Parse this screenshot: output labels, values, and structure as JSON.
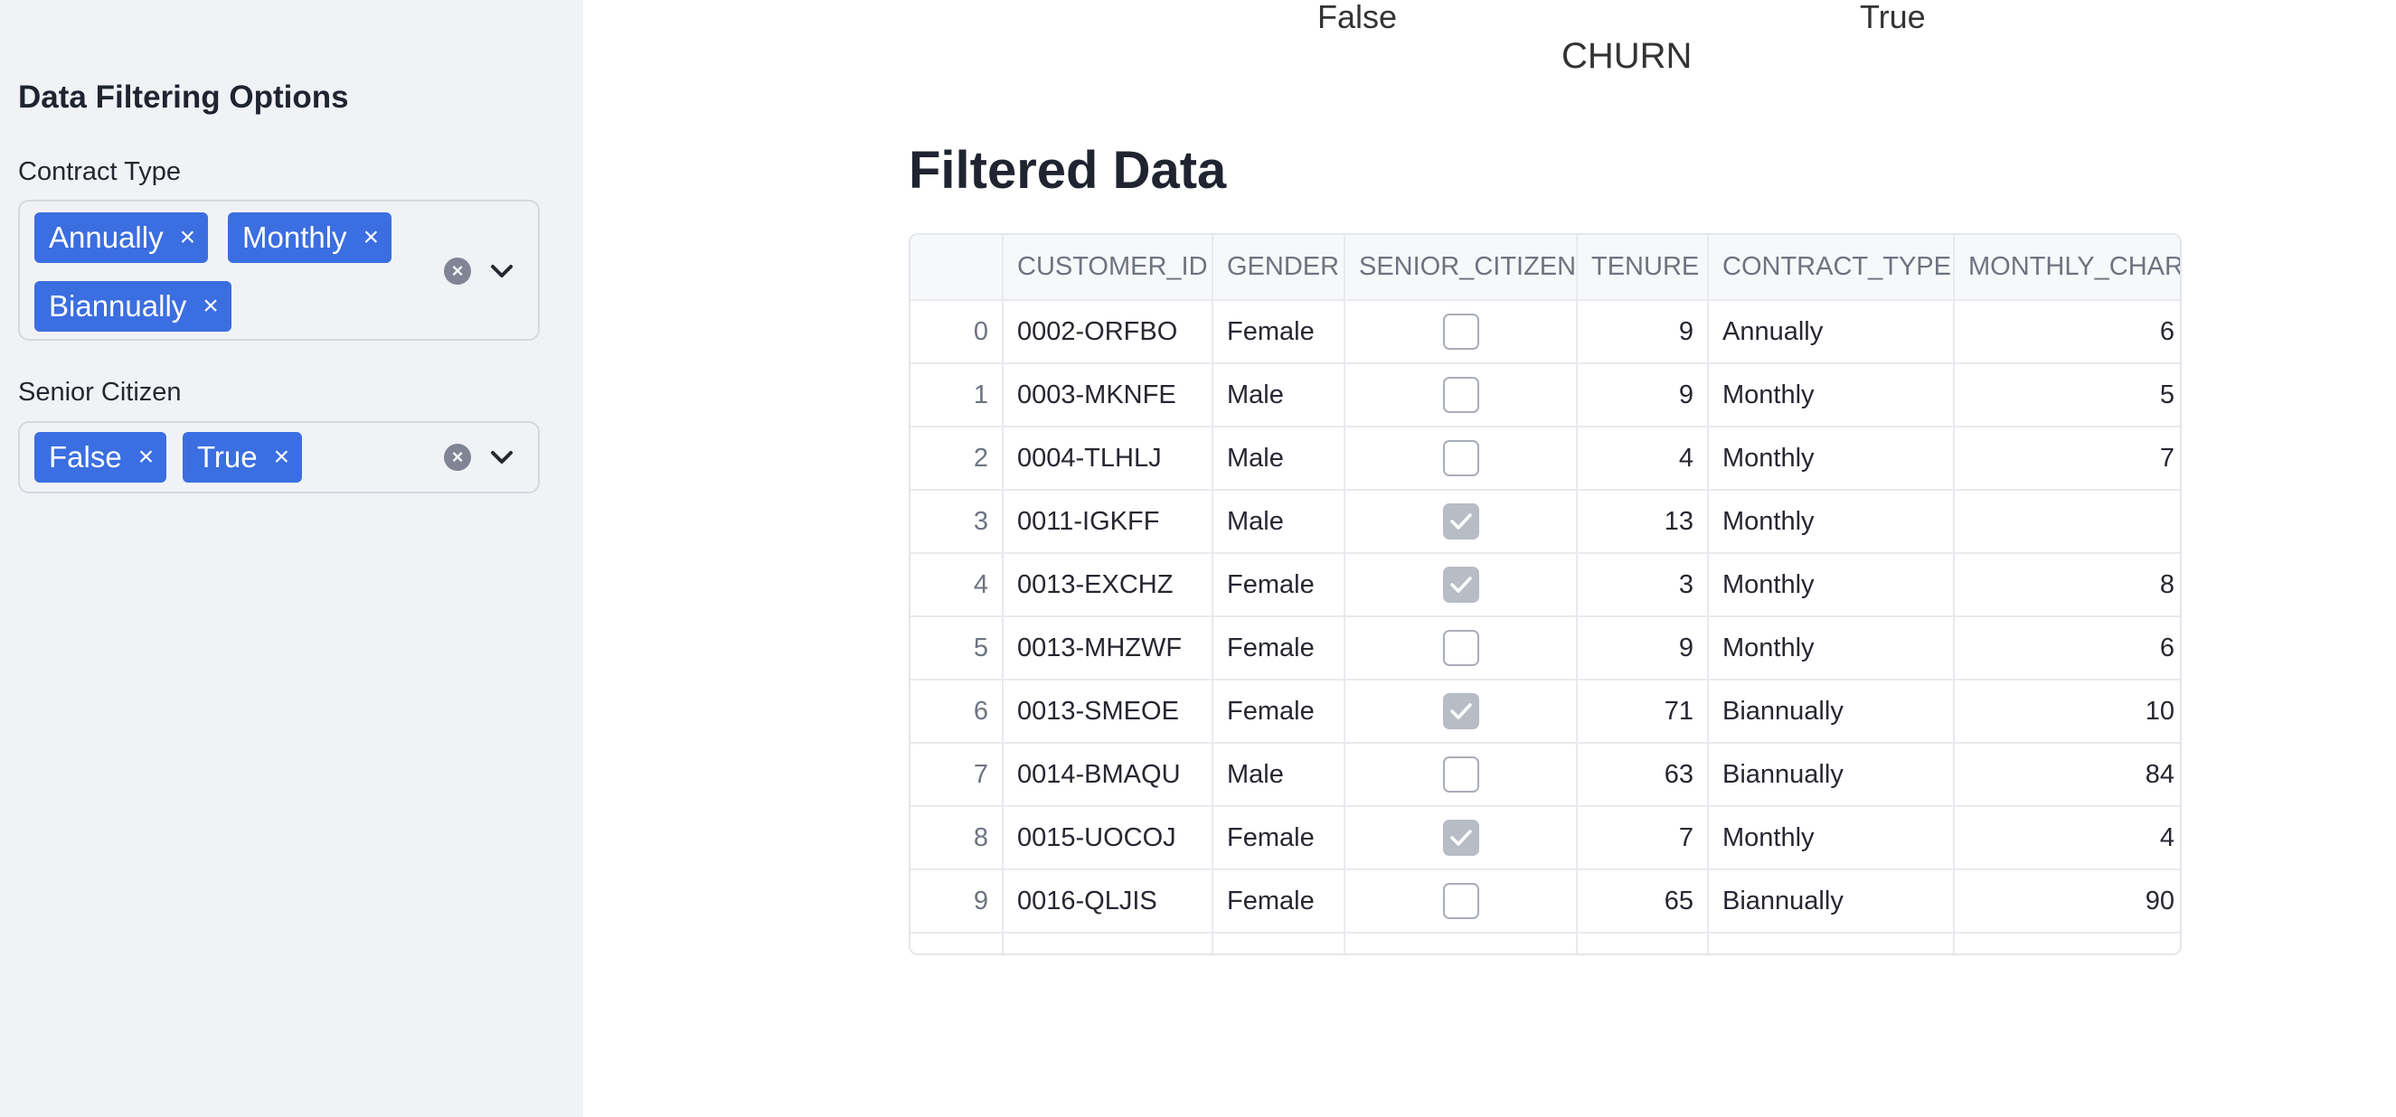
{
  "sidebar": {
    "title": "Data Filtering Options",
    "contract_type": {
      "label": "Contract Type",
      "selected": [
        "Annually",
        "Monthly",
        "Biannually"
      ]
    },
    "senior_citizen": {
      "label": "Senior Citizen",
      "selected": [
        "False",
        "True"
      ]
    },
    "tag_remove_glyph": "×",
    "clear_glyph": "×"
  },
  "chart": {
    "x_tick_labels": [
      "False",
      "True"
    ],
    "x_axis_title": "CHURN"
  },
  "main": {
    "heading": "Filtered Data",
    "table": {
      "columns": [
        "",
        "CUSTOMER_ID",
        "GENDER",
        "SENIOR_CITIZEN",
        "TENURE",
        "CONTRACT_TYPE",
        "MONTHLY_CHARGES"
      ],
      "rows": [
        {
          "index": "0",
          "customer_id": "0002-ORFBO",
          "gender": "Female",
          "senior_citizen": false,
          "tenure": "9",
          "contract_type": "Annually",
          "monthly_charges": "6"
        },
        {
          "index": "1",
          "customer_id": "0003-MKNFE",
          "gender": "Male",
          "senior_citizen": false,
          "tenure": "9",
          "contract_type": "Monthly",
          "monthly_charges": "5"
        },
        {
          "index": "2",
          "customer_id": "0004-TLHLJ",
          "gender": "Male",
          "senior_citizen": false,
          "tenure": "4",
          "contract_type": "Monthly",
          "monthly_charges": "7"
        },
        {
          "index": "3",
          "customer_id": "0011-IGKFF",
          "gender": "Male",
          "senior_citizen": true,
          "tenure": "13",
          "contract_type": "Monthly",
          "monthly_charges": ""
        },
        {
          "index": "4",
          "customer_id": "0013-EXCHZ",
          "gender": "Female",
          "senior_citizen": true,
          "tenure": "3",
          "contract_type": "Monthly",
          "monthly_charges": "8"
        },
        {
          "index": "5",
          "customer_id": "0013-MHZWF",
          "gender": "Female",
          "senior_citizen": false,
          "tenure": "9",
          "contract_type": "Monthly",
          "monthly_charges": "6"
        },
        {
          "index": "6",
          "customer_id": "0013-SMEOE",
          "gender": "Female",
          "senior_citizen": true,
          "tenure": "71",
          "contract_type": "Biannually",
          "monthly_charges": "10"
        },
        {
          "index": "7",
          "customer_id": "0014-BMAQU",
          "gender": "Male",
          "senior_citizen": false,
          "tenure": "63",
          "contract_type": "Biannually",
          "monthly_charges": "84"
        },
        {
          "index": "8",
          "customer_id": "0015-UOCOJ",
          "gender": "Female",
          "senior_citizen": true,
          "tenure": "7",
          "contract_type": "Monthly",
          "monthly_charges": "4"
        },
        {
          "index": "9",
          "customer_id": "0016-QLJIS",
          "gender": "Female",
          "senior_citizen": false,
          "tenure": "65",
          "contract_type": "Biannually",
          "monthly_charges": "90"
        }
      ]
    }
  },
  "colors": {
    "tag_background": "#3b6ee0",
    "sidebar_background": "#f0f2f6"
  }
}
